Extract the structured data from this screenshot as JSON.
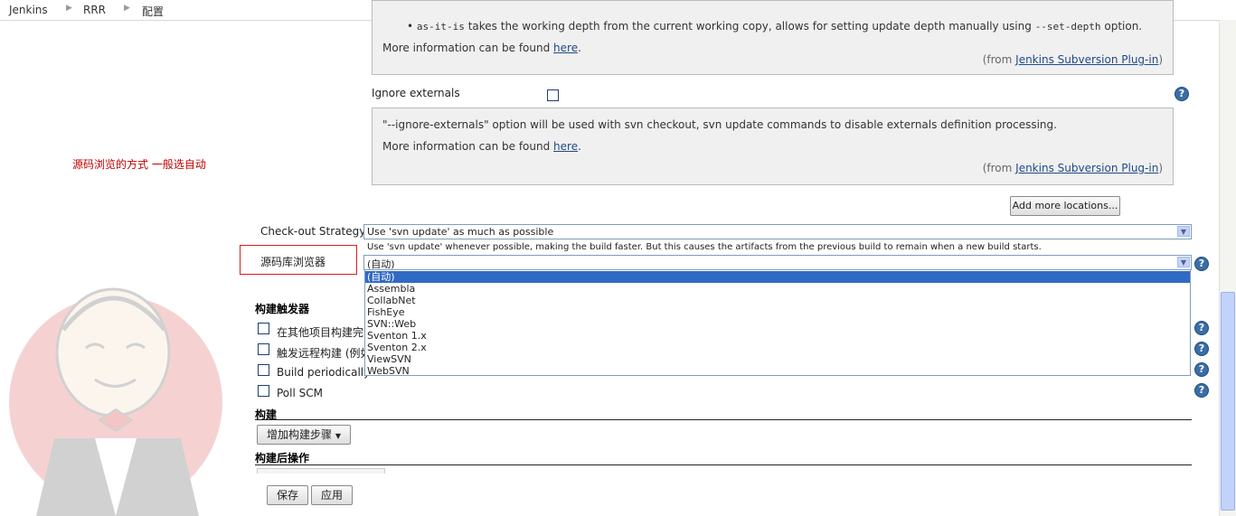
{
  "breadcrumb": {
    "items": [
      "Jenkins",
      "RRR",
      "配置"
    ]
  },
  "depth_help": {
    "bullet_term": "as-it-is",
    "bullet_text": " takes the working depth from the current working copy, allows for setting update depth manually using ",
    "bullet_option": "--set-depth",
    "bullet_tail": " option.",
    "more_info_prefix": "More information can be found ",
    "link": "here",
    "more_info_suffix": ".",
    "from_prefix": "(from ",
    "from_link": "Jenkins Subversion Plug-in",
    "from_suffix": ")"
  },
  "ignore_externals": {
    "label": "Ignore externals",
    "checked": false,
    "help_text": "\"--ignore-externals\" option will be used with svn checkout, svn update commands to disable externals definition processing.",
    "more_info_prefix": "More information can be found ",
    "link": "here",
    "more_info_suffix": ".",
    "from_prefix": "(from ",
    "from_link": "Jenkins Subversion Plug-in",
    "from_suffix": ")"
  },
  "add_locations_label": "Add more locations...",
  "checkout_strategy": {
    "label": "Check-out Strategy",
    "value": "Use 'svn update' as much as possible",
    "description": "Use 'svn update' whenever possible, making the build faster. But this causes the artifacts from the previous build to remain when a new build starts."
  },
  "repo_browser": {
    "label": "源码库浏览器",
    "value": "(自动)",
    "options": [
      "(自动)",
      "Assembla",
      "CollabNet",
      "FishEye",
      "SVN::Web",
      "Sventon 1.x",
      "Sventon 2.x",
      "ViewSVN",
      "WebSVN"
    ],
    "selected_index": 0
  },
  "annotation_note": "源码浏览的方式    一般选自动",
  "triggers": {
    "title": "构建触发器",
    "items": [
      {
        "label": "在其他项目构建完",
        "checked": false
      },
      {
        "label": "触发远程构建 (例如",
        "checked": false
      },
      {
        "label": "Build periodically",
        "checked": false
      },
      {
        "label": "Poll SCM",
        "checked": false
      }
    ]
  },
  "build": {
    "title": "构建",
    "add_step_label": "增加构建步骤"
  },
  "post_build": {
    "title": "构建后操作"
  },
  "actions": {
    "save_label": "保存",
    "apply_label": "应用"
  },
  "help_icon_glyph": "?",
  "colors": {
    "annotation": "#c00000",
    "link": "#204a87",
    "selection": "#316ac5",
    "help_box_bg": "#f0f0f0"
  }
}
